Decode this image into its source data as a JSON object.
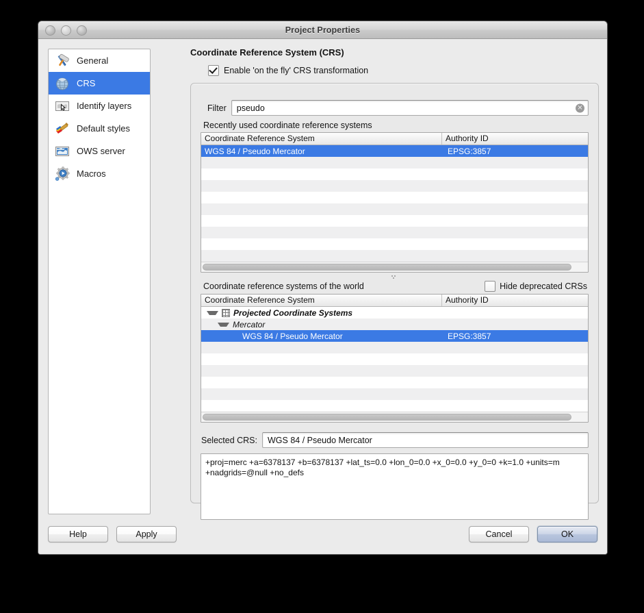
{
  "window": {
    "title": "Project Properties",
    "controls": [
      "close-button",
      "minimize-button",
      "zoom-button"
    ]
  },
  "sidebar": {
    "items": [
      {
        "label": "General",
        "icon": "hammer-wrench-icon",
        "selected": false
      },
      {
        "label": "CRS",
        "icon": "globe-icon",
        "selected": true
      },
      {
        "label": "Identify layers",
        "icon": "map-cursor-icon",
        "selected": false
      },
      {
        "label": "Default styles",
        "icon": "paintbrush-icon",
        "selected": false
      },
      {
        "label": "OWS server",
        "icon": "map-server-icon",
        "selected": false
      },
      {
        "label": "Macros",
        "icon": "gear-play-icon",
        "selected": false
      }
    ]
  },
  "pane": {
    "title": "Coordinate Reference System (CRS)",
    "enable_checkbox": {
      "label": "Enable 'on the fly' CRS transformation",
      "checked": true
    },
    "filter": {
      "label": "Filter",
      "value": "pseudo",
      "placeholder": "",
      "clear_icon": "clear-circle-icon"
    },
    "recent": {
      "section_label": "Recently used coordinate reference systems",
      "columns": [
        "Coordinate Reference System",
        "Authority ID"
      ],
      "rows": [
        {
          "name": "WGS 84 / Pseudo Mercator",
          "authority": "EPSG:3857",
          "selected": true
        }
      ],
      "empty_row_count": 9,
      "hscroll_percent": 96
    },
    "world": {
      "section_label": "Coordinate reference systems of the world",
      "hide_deprecated": {
        "label": "Hide deprecated CRSs",
        "checked": false
      },
      "columns": [
        "Coordinate Reference System",
        "Authority ID"
      ],
      "rows": [
        {
          "name": "Projected Coordinate Systems",
          "authority": "",
          "level": 1,
          "kind": "group",
          "expanded": true,
          "icon": "grid-icon",
          "selected": false
        },
        {
          "name": "Mercator",
          "authority": "",
          "level": 2,
          "kind": "subgroup",
          "expanded": true,
          "icon": "disclosure-icon",
          "selected": false
        },
        {
          "name": "WGS 84 / Pseudo Mercator",
          "authority": "EPSG:3857",
          "level": 3,
          "kind": "leaf",
          "expanded": false,
          "icon": "",
          "selected": true
        }
      ],
      "empty_row_count": 5,
      "hscroll_percent": 96
    },
    "selected_crs": {
      "label": "Selected CRS:",
      "value": "WGS 84 / Pseudo Mercator"
    },
    "proj_definition": "+proj=merc +a=6378137 +b=6378137 +lat_ts=0.0 +lon_0=0.0 +x_0=0.0 +y_0=0 +k=1.0 +units=m +nadgrids=@null +no_defs"
  },
  "footer": {
    "help": "Help",
    "apply": "Apply",
    "cancel": "Cancel",
    "ok": "OK"
  },
  "colors": {
    "selection_blue": "#3b7ae4",
    "window_bg": "#ebebeb",
    "groupbox_bg": "#e9e9e9",
    "row_alt": "#efeff0"
  }
}
